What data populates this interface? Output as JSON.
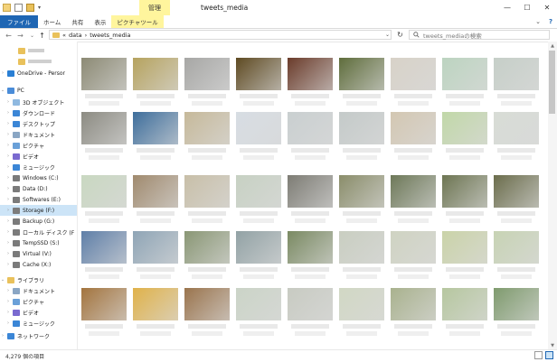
{
  "window": {
    "title": "tweets_media",
    "context_tab": "管理",
    "buttons": {
      "minimize": "—",
      "maximize": "☐",
      "close": "✕"
    }
  },
  "ribbon": {
    "tabs": [
      "ファイル",
      "ホーム",
      "共有",
      "表示",
      "ピクチャツール"
    ],
    "help_chevron": "⌄",
    "help": "?"
  },
  "nav": {
    "back": "←",
    "forward": "→",
    "recent": "⌄",
    "up": "↑",
    "breadcrumb": [
      "«",
      "data",
      "›",
      "tweets_media"
    ],
    "dropdown": "⌄",
    "refresh": "↻",
    "search_placeholder": "tweets_mediaの検索"
  },
  "sidebar": [
    {
      "label": "",
      "icon": "folder",
      "blur": 18
    },
    {
      "label": "",
      "icon": "folder",
      "blur": 26
    },
    {
      "label": "OneDrive - Persor",
      "icon": "cloud"
    },
    {
      "label": "PC",
      "icon": "pc"
    },
    {
      "label": "3D オブジェクト",
      "icon": "cube"
    },
    {
      "label": "ダウンロード",
      "icon": "download"
    },
    {
      "label": "デスクトップ",
      "icon": "desktop"
    },
    {
      "label": "ドキュメント",
      "icon": "documents"
    },
    {
      "label": "ピクチャ",
      "icon": "pictures"
    },
    {
      "label": "ビデオ",
      "icon": "videos"
    },
    {
      "label": "ミュージック",
      "icon": "music"
    },
    {
      "label": "Windows (C:)",
      "icon": "drive"
    },
    {
      "label": "Data (D:)",
      "icon": "drive"
    },
    {
      "label": "Softwares (E:)",
      "icon": "drive"
    },
    {
      "label": "Storage (F:)",
      "icon": "drive",
      "selected": true
    },
    {
      "label": "Backup (G:)",
      "icon": "drive"
    },
    {
      "label": "ローカル ディスク (F",
      "icon": "drive"
    },
    {
      "label": "TempSSD (S:)",
      "icon": "drive"
    },
    {
      "label": "Virtual (V:)",
      "icon": "drive"
    },
    {
      "label": "Cache (X:)",
      "icon": "drive"
    },
    {
      "label": "ライブラリ",
      "icon": "library"
    },
    {
      "label": "ドキュメント",
      "icon": "documents"
    },
    {
      "label": "ピクチャ",
      "icon": "pictures"
    },
    {
      "label": "ビデオ",
      "icon": "videos"
    },
    {
      "label": "ミュージック",
      "icon": "music"
    },
    {
      "label": "ネットワーク",
      "icon": "network"
    }
  ],
  "status": {
    "item_count": "4,279 個の項目"
  },
  "colors": {
    "accent": "#1f66b3",
    "selection": "#cce4f7",
    "context_tab": "#fff59d"
  },
  "thumbnails": [
    [
      "#8c8a74",
      "#b6a35f",
      "#a7a7a5",
      "#5e4a22",
      "#6a3b2a",
      "#5f6d3c",
      "#d8d2c8",
      "#bcd4c0",
      "#c6cfc8"
    ],
    [
      "#8c8b82",
      "#3e6e9c",
      "#c6b99a",
      "#d7dde3",
      "#c9cfd0",
      "#c4cac9",
      "#d3c7b2",
      "#c1d8a8",
      "#d8dcd6"
    ],
    [
      "#c9d8c1",
      "#a08a6e",
      "#c8bfa8",
      "#c7d1c3",
      "#7d7c74",
      "#8a8d6a",
      "#6d7858",
      "#6d7552",
      "#6b6d4c"
    ],
    [
      "#5f7fa8",
      "#8fa5b6",
      "#8a9775",
      "#92a2a5",
      "#7a8a62",
      "#c9cec1",
      "#cfd3c2",
      "#cad3a8",
      "#c7d3b4"
    ],
    [
      "#a3743e",
      "#e0b24a",
      "#9a744d",
      "#cbd4c7",
      "#c8cbc2",
      "#d1d8c4",
      "#a9b28e",
      "#b6c79f",
      "#7f9b6e"
    ]
  ]
}
